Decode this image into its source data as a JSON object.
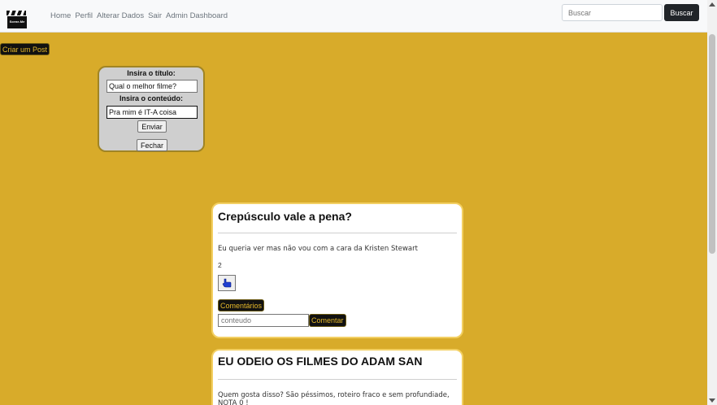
{
  "navbar": {
    "logo_text": "Scene-Me",
    "links": [
      "Home",
      "Perfil",
      "Alterar Dados",
      "Sair",
      "Admin Dashboard"
    ],
    "search_placeholder": "Buscar",
    "search_button": "Buscar"
  },
  "create_post_button": "Criar um Post",
  "form": {
    "title_label": "Insira o título:",
    "title_value": "Qual o melhor filme?",
    "content_label": "Insira o conteúdo:",
    "content_value": "Pra mim é IT-A coisa",
    "send_button": "Enviar",
    "close_button": "Fechar"
  },
  "posts": [
    {
      "title": "Crepúsculo vale a pena?",
      "content": "Eu queria ver mas não vou com a cara da Kristen Stewart",
      "likes": "2",
      "comments_button": "Comentários",
      "comment_placeholder": "conteudo",
      "comment_button": "Comentar"
    },
    {
      "title": "EU ODEIO OS FILMES DO ADAM SAN",
      "content": "Quem gosta disso? São péssimos, roteiro fraco e sem profundiade, NOTA 0 !"
    }
  ],
  "colors": {
    "background": "#d8ab2a",
    "dark_button": "#111111",
    "dark_button_text": "#e6b92a",
    "card_border": "#f3d063"
  }
}
